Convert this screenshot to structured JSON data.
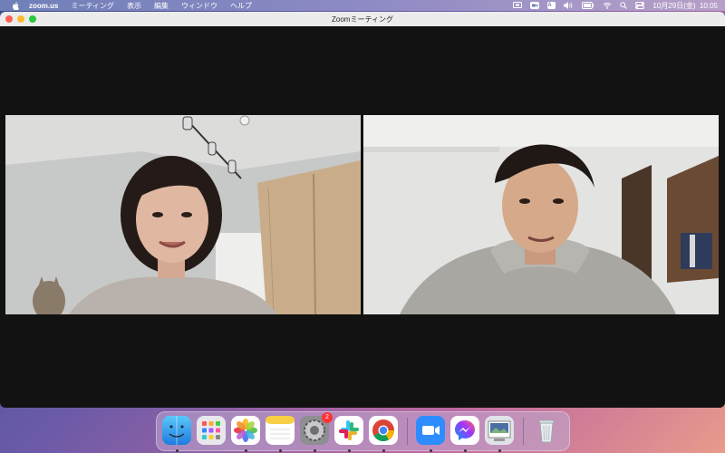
{
  "menubar": {
    "app_name": "zoom.us",
    "menus": [
      "ミーティング",
      "表示",
      "編集",
      "ウィンドウ",
      "ヘルプ"
    ],
    "input_indicator": "A",
    "datetime": "10月29日(金)  10:05"
  },
  "window": {
    "title": "Zoomミーティング"
  },
  "participants": [
    {
      "name_icon": "woman-video-feed"
    },
    {
      "name_icon": "man-video-feed"
    }
  ],
  "dock": {
    "items": [
      {
        "name": "finder",
        "running": true
      },
      {
        "name": "launchpad",
        "running": false
      },
      {
        "name": "photos",
        "running": true
      },
      {
        "name": "notes",
        "running": true
      },
      {
        "name": "system-preferences",
        "running": true,
        "badge": "2"
      },
      {
        "name": "slack",
        "running": true
      },
      {
        "name": "chrome",
        "running": true
      },
      {
        "name": "zoom",
        "running": true
      },
      {
        "name": "messenger",
        "running": true
      },
      {
        "name": "preview",
        "running": true
      },
      {
        "name": "trash",
        "running": false
      }
    ]
  }
}
